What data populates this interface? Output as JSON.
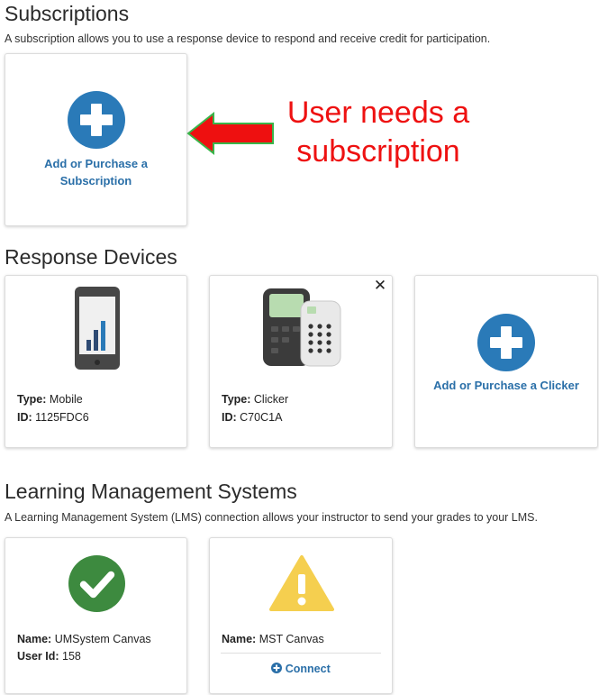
{
  "subscriptions": {
    "title": "Subscriptions",
    "description": "A subscription allows you to use a response device to respond and receive credit for participation.",
    "add_label": "Add or Purchase a Subscription"
  },
  "annotation": {
    "text": "User needs a subscription",
    "color": "#ee1111"
  },
  "devices": {
    "title": "Response Devices",
    "items": [
      {
        "type_label": "Type:",
        "type_value": "Mobile",
        "id_label": "ID:",
        "id_value": "1125FDC6",
        "icon": "mobile-phone-icon"
      },
      {
        "type_label": "Type:",
        "type_value": "Clicker",
        "id_label": "ID:",
        "id_value": "C70C1A",
        "icon": "clicker-remote-icon",
        "close": "✕"
      }
    ],
    "add_label": "Add or Purchase a Clicker"
  },
  "lms": {
    "title": "Learning Management Systems",
    "description": "A Learning Management System (LMS) connection allows your instructor to send your grades to your LMS.",
    "items": [
      {
        "name_label": "Name:",
        "name_value": "UMSystem Canvas",
        "user_label": "User Id:",
        "user_value": "158",
        "status": "connected",
        "icon": "check-circle-icon"
      },
      {
        "name_label": "Name:",
        "name_value": "MST Canvas",
        "status": "warning",
        "icon": "warning-triangle-icon",
        "connect_label": "Connect"
      }
    ]
  },
  "colors": {
    "accent_blue": "#2a7ab8",
    "link_blue": "#2a6fa8",
    "success_green": "#3d8a3f",
    "warning_yellow": "#f5cf4f",
    "annotation_red": "#ee1111"
  }
}
